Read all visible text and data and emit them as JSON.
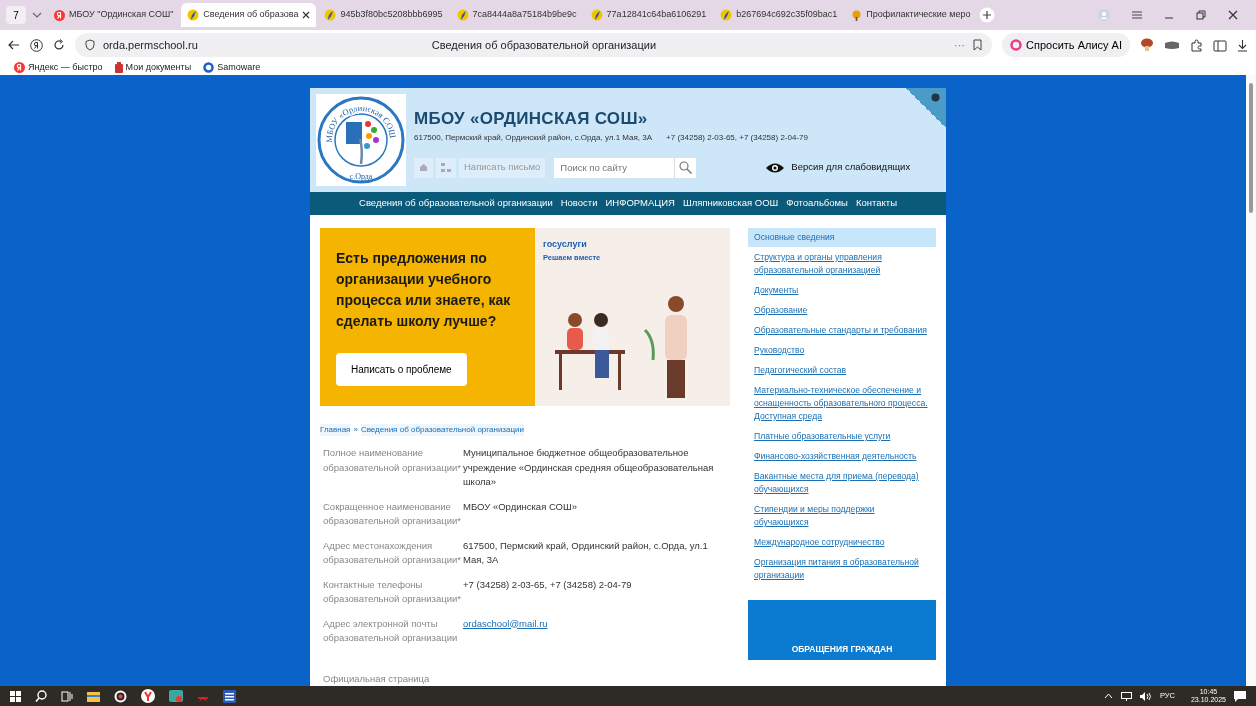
{
  "browser": {
    "tab_count": "7",
    "tabs": [
      {
        "title": "МБОУ \"Ординская СОШ\"",
        "selected": false,
        "kind": "yandex"
      },
      {
        "title": "Сведения об образова",
        "selected": true,
        "kind": "school"
      },
      {
        "title": "945b3f80bc5208bbb6995",
        "selected": false,
        "kind": "school"
      },
      {
        "title": "7ca8444a8a75184b9be9c",
        "selected": false,
        "kind": "school"
      },
      {
        "title": "77a12841c64ba6106291",
        "selected": false,
        "kind": "school"
      },
      {
        "title": "b267694c692c35f09bac1",
        "selected": false,
        "kind": "school"
      },
      {
        "title": "Профилактические меро",
        "selected": false,
        "kind": "tree"
      }
    ],
    "address": "orda.permschool.ru",
    "page_title": "Сведения об образовательной организации",
    "more": "···",
    "alice": "Спросить Алису AI",
    "bookmarks": [
      {
        "title": "Яндекс — быстро",
        "kind": "yandex"
      },
      {
        "title": "Мои документы",
        "kind": "doc"
      },
      {
        "title": "Samoware",
        "kind": "ring"
      }
    ]
  },
  "site": {
    "logo_top": "МБОУ «Ординская СОШ»",
    "logo_bottom": "с.Орда",
    "name": "МБОУ «ОРДИНСКАЯ СОШ»",
    "address": "617500, Пермский край, Ординский район, с.Орда, ул.1 Мая, 3А",
    "phones": "+7 (34258) 2-03-65, +7 (34258) 2-04-79",
    "write_letter": "Написать письмо",
    "search": {
      "placeholder": "Поиск по сайту"
    },
    "low_vision": "Версия для слабовидящих",
    "nav": [
      "Сведения об образовательной организации",
      "Новости",
      "ИНФОРМАЦИЯ",
      "Шляпниковская ООШ",
      "Фотоальбомы",
      "Контакты"
    ],
    "banner": {
      "heading": "Есть предложения по организации учебного процесса или знаете, как сделать школу лучше?",
      "button": "Написать о проблеме",
      "brand": "госуслуги",
      "slogan": "Решаем вместе"
    },
    "breadcrumb": {
      "items": [
        "Главная",
        "Сведения об образовательной организации"
      ],
      "separator": "»"
    },
    "fields": [
      {
        "label": "Полное наименование образовательной организации*",
        "value": "Муниципальное бюджетное общеобразовательное учреждение «Ординская средняя общеобразовательная школа»",
        "kind": "text"
      },
      {
        "label": "Сокращенное наименование образовательной организации*",
        "value": "МБОУ «Ординская СОШ»",
        "kind": "text"
      },
      {
        "label": "Адрес местонахождения образовательной организации*",
        "value": "617500, Пермский край, Ординский район, с.Орда, ул.1 Мая, 3А",
        "kind": "text"
      },
      {
        "label": "Контактные телефоны образовательной организации*",
        "value": "+7 (34258) 2-03-65, +7 (34258) 2-04-79",
        "kind": "text"
      },
      {
        "label": "Адрес электронной почты образовательной организации",
        "value": "ordaschool@mail.ru",
        "kind": "link"
      },
      {
        "label": "Официальная страница"
      }
    ],
    "side_menu": [
      {
        "label": "Основные сведения",
        "selected": true
      },
      {
        "label": "Структура и органы управления образовательной организацией",
        "selected": false
      },
      {
        "label": "Документы",
        "selected": false
      },
      {
        "label": "Образование",
        "selected": false
      },
      {
        "label": "Образовательные стандарты и требования",
        "selected": false
      },
      {
        "label": "Руководство",
        "selected": false
      },
      {
        "label": "Педагогический состав",
        "selected": false
      },
      {
        "label": "Материально-техническое обеспечение и оснащенность образовательного процесса. Доступная среда",
        "selected": false
      },
      {
        "label": "Платные образовательные услуги",
        "selected": false
      },
      {
        "label": "Финансово-хозяйственная деятельность",
        "selected": false
      },
      {
        "label": "Вакантные места для приема (перевода) обучающихся",
        "selected": false
      },
      {
        "label": "Стипендии и меры поддержки обучающихся",
        "selected": false
      },
      {
        "label": "Международное сотрудничество",
        "selected": false
      },
      {
        "label": "Организация питания в образовательной организации",
        "selected": false
      }
    ],
    "appeal": "ОБРАЩЕНИЯ ГРАЖДАН"
  },
  "taskbar": {
    "lang": "РУС",
    "time": "10:45",
    "date": "23.10.2025"
  }
}
